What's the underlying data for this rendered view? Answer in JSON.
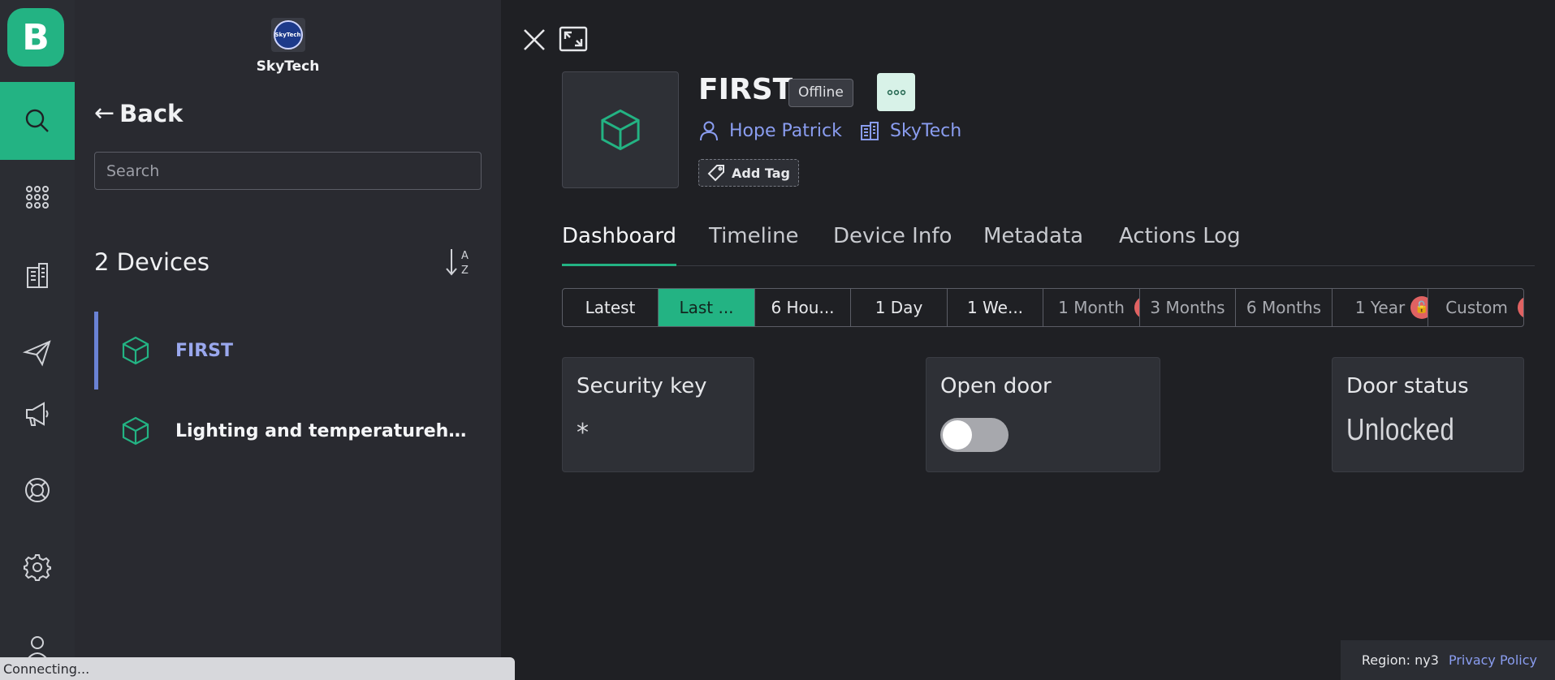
{
  "app": {
    "logo_letter": "B"
  },
  "rail": {
    "items": [
      {
        "name": "search-icon",
        "active": true
      },
      {
        "name": "grid-icon"
      },
      {
        "name": "building-icon"
      },
      {
        "name": "send-icon"
      },
      {
        "name": "megaphone-icon"
      },
      {
        "name": "lifebuoy-icon"
      },
      {
        "name": "gear-icon"
      },
      {
        "name": "user-icon"
      }
    ]
  },
  "org": {
    "name": "SkyTech",
    "logo_text": "SkyTech"
  },
  "sidebar": {
    "back_label": "Back",
    "search_placeholder": "Search",
    "device_count": "2 Devices",
    "devices": [
      {
        "name": "FIRST",
        "selected": true
      },
      {
        "name": "Lighting and temperaturehumidity"
      }
    ]
  },
  "status": {
    "text": "Connecting..."
  },
  "device": {
    "name": "FIRST",
    "status": "Offline",
    "owner": "Hope Patrick",
    "organization": "SkyTech",
    "add_tag_label": "Add Tag"
  },
  "tabs": [
    {
      "label": "Dashboard",
      "active": true
    },
    {
      "label": "Timeline"
    },
    {
      "label": "Device Info"
    },
    {
      "label": "Metadata"
    },
    {
      "label": "Actions Log"
    }
  ],
  "time_ranges": [
    {
      "label": "Latest"
    },
    {
      "label": "Last ...",
      "active": true
    },
    {
      "label": "6 Hou..."
    },
    {
      "label": "1 Day"
    },
    {
      "label": "1 We..."
    },
    {
      "label": "1 Month",
      "locked": true
    },
    {
      "label": "3 Months"
    },
    {
      "label": "6 Months"
    },
    {
      "label": "1 Year",
      "locked": true
    },
    {
      "label": "Custom",
      "locked": true
    }
  ],
  "widgets": {
    "security_key": {
      "title": "Security key",
      "value": "*"
    },
    "open_door": {
      "title": "Open door",
      "state": "off"
    },
    "door_status": {
      "title": "Door status",
      "value": "Unlocked"
    }
  },
  "footer": {
    "region": "Region: ny3",
    "privacy": "Privacy Policy"
  },
  "colors": {
    "accent": "#23b383",
    "link": "#8a9df0",
    "bg": "#1f2024",
    "panel": "#292a30",
    "rail": "#2b2d33"
  }
}
